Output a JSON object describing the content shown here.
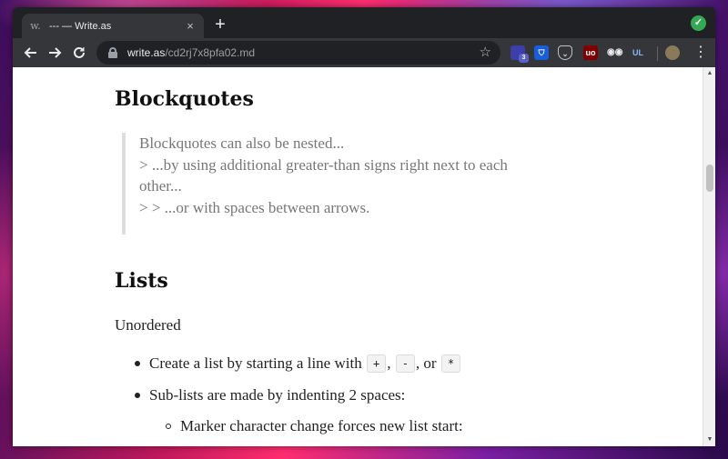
{
  "browser": {
    "tab": {
      "favicon": "w.",
      "title": "--- — Write.as",
      "close": "×"
    },
    "new_tab": "+",
    "url_host": "write.as",
    "url_path": "/cd2rj7x8pfa02.md",
    "ext_badge": "3",
    "icons": {
      "back": "back-arrow-icon",
      "forward": "forward-arrow-icon",
      "reload": "reload-icon",
      "lock": "lock-icon",
      "star": "bookmark-star-icon",
      "menu": "kebab-menu-icon"
    }
  },
  "article": {
    "h_blockquotes": "Blockquotes",
    "bq_line1": "Blockquotes can also be nested...",
    "bq_line2": "> ...by using additional greater-than signs right next to each",
    "bq_line3": "other...",
    "bq_line4": "> > ...or with spaces between arrows.",
    "h_lists": "Lists",
    "unordered": "Unordered",
    "li1_pre": "Create a list by starting a line with",
    "li1_code1": "+",
    "li1_sep1": ",",
    "li1_code2": "-",
    "li1_sep2": ", or",
    "li1_code3": "*",
    "li2": "Sub-lists are made by indenting 2 spaces:",
    "li3": "Marker character change forces new list start:"
  }
}
